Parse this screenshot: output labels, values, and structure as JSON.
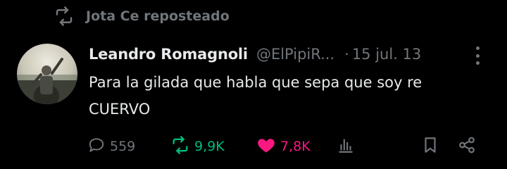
{
  "repost": {
    "label": "Jota Ce reposteado",
    "icon": "repost-icon"
  },
  "tweet": {
    "display_name": "Leandro Romagnoli",
    "handle": "@ElPipiR...",
    "separator": "·",
    "date": "15 jul. 13",
    "text_line1": "Para la gilada que habla que sepa que soy re",
    "text_line2": "CUERVO"
  },
  "actions": {
    "reply": {
      "icon": "reply-icon",
      "count": "559"
    },
    "retweet": {
      "icon": "retweet-icon",
      "count": "9,9K",
      "color": "#00ba7c"
    },
    "like": {
      "icon": "heart-icon",
      "count": "7,8K",
      "color": "#f91880"
    },
    "views": {
      "icon": "views-icon"
    },
    "bookmark": {
      "icon": "bookmark-icon"
    },
    "share": {
      "icon": "share-icon"
    }
  },
  "colors": {
    "background": "#000000",
    "text": "#e7e9ea",
    "muted": "#71767b"
  }
}
